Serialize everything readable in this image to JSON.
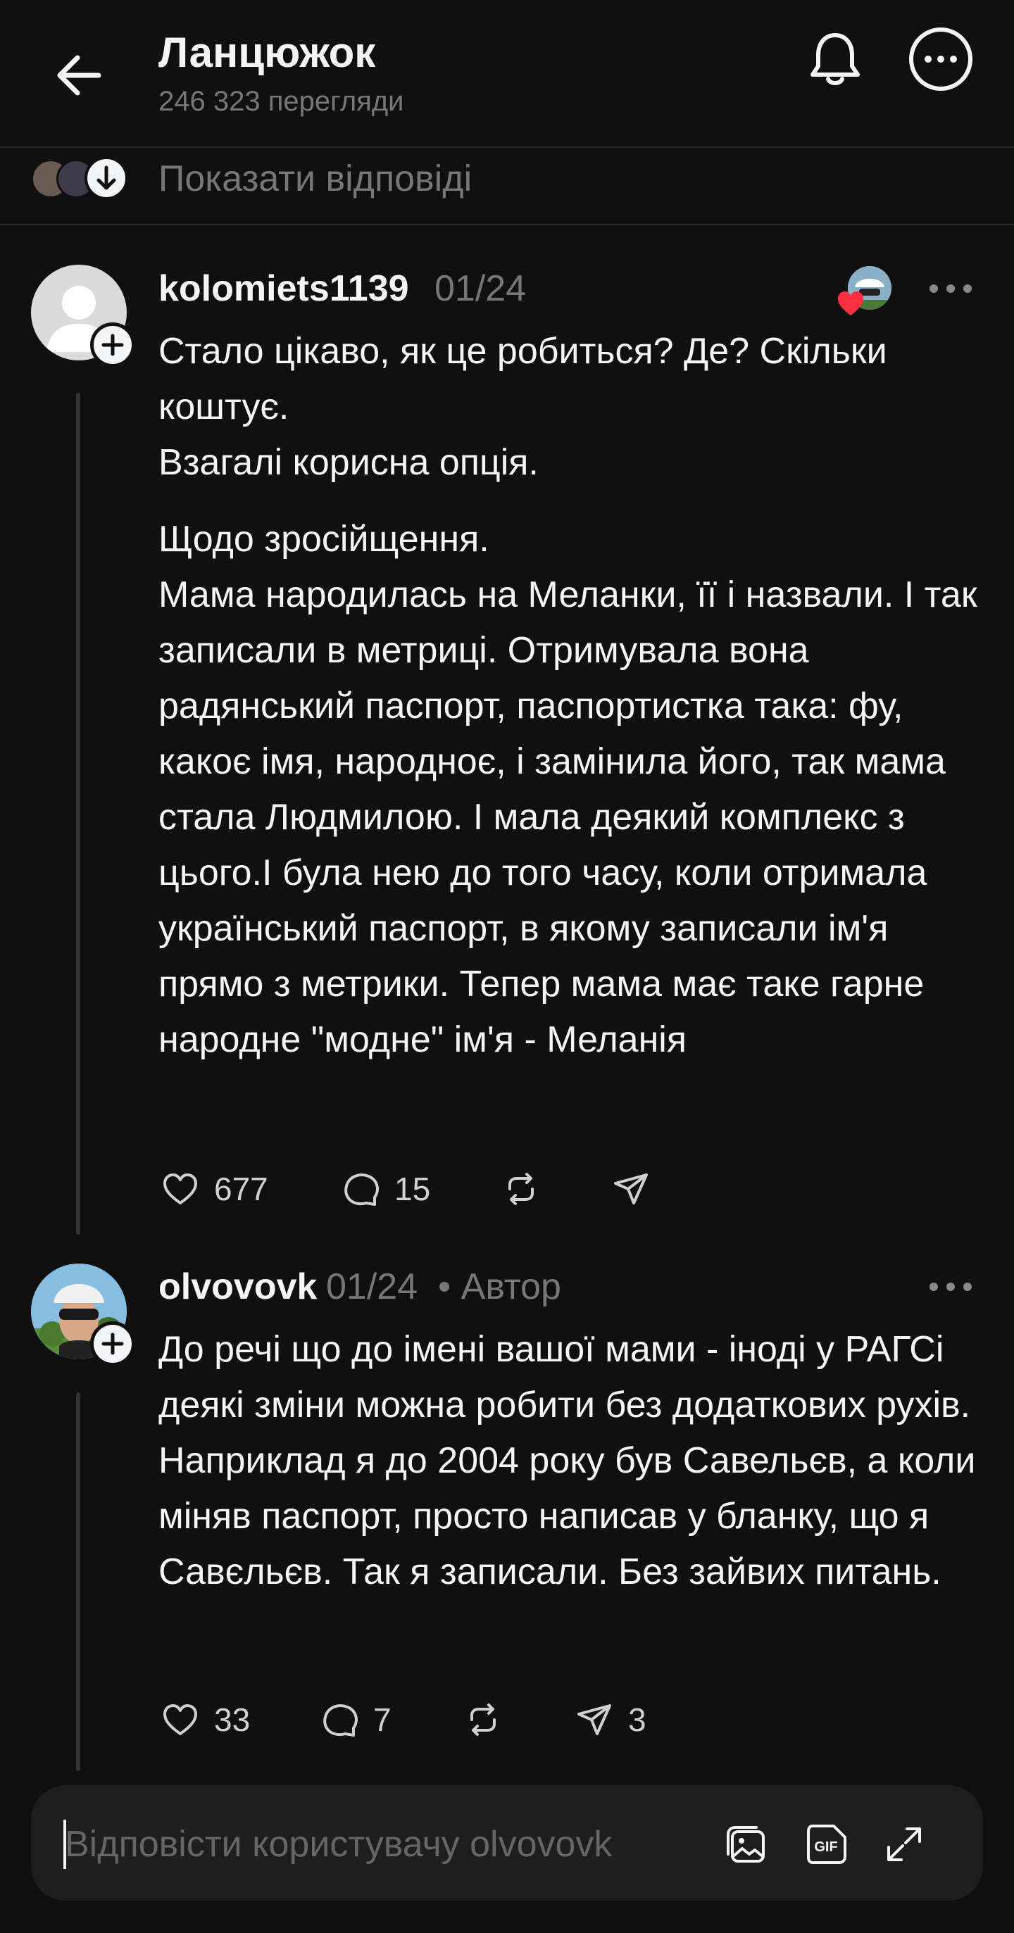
{
  "header": {
    "title": "Ланцюжок",
    "views": "246 323 перегляди"
  },
  "show_replies": {
    "label": "Показати відповіді"
  },
  "posts": [
    {
      "username": "kolomiets1139",
      "date": "01/24",
      "author_label": "",
      "text": "Стало цікаво,  як це робиться? Де? Скільки коштує.\nВзагалі корисна опція.",
      "text2": "Щодо зросійщення.\nМама народилась на Меланки, її і назвали. І так записали в метриці. Отримувала вона радянський паспорт, паспортистка така: фу, какоє імя, народноє, і замінила його, так мама стала Людмилою. І мала деякий комплекс з цього.І була нею до того часу, коли отримала український паспорт, в якому записали ім'я прямо з метрики. Тепер мама має таке гарне народне \"модне\" ім'я - Меланія",
      "likes": "677",
      "comments": "15",
      "shares": ""
    },
    {
      "username": "olvovovk",
      "date": "01/24",
      "author_label": "• Автор",
      "text": "До речі що до імені вашої мами - іноді у РАГСі деякі зміни можна робити без додаткових рухів. Наприклад я до 2004 року був Савельєв, а коли міняв паспорт, просто написав у бланку, що я Савєльєв. Так я записали. Без зайвих питань.",
      "likes": "33",
      "comments": "7",
      "shares": "3"
    }
  ],
  "reply_bar": {
    "placeholder": "Відповісти користувачу olvovovk"
  },
  "colors": {
    "background": "#101010",
    "text": "#f3f5f7",
    "muted": "#777777",
    "like_heart": "#ff3040",
    "input_bg": "#1e1e1e"
  },
  "icons": [
    "back-arrow-icon",
    "bell-icon",
    "more-icon",
    "arrow-down-icon",
    "plus-icon",
    "heart-icon",
    "comment-icon",
    "repost-icon",
    "send-icon",
    "image-icon",
    "gif-icon",
    "expand-icon"
  ]
}
